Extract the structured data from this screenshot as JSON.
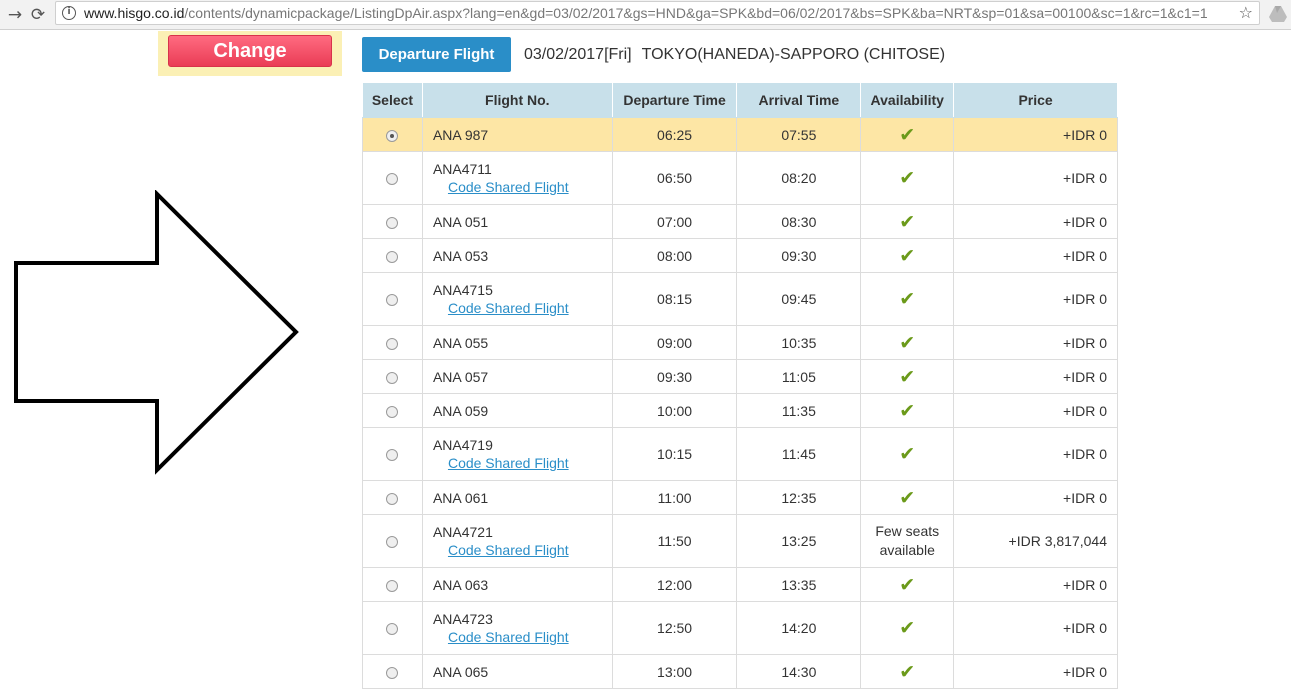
{
  "browser": {
    "back_glyph": "→",
    "reload_glyph": "⟳",
    "url_host": "www.hisgo.co.id",
    "url_path": "/contents/dynamicpackage/ListingDpAir.aspx?lang=en&gd=03/02/2017&gs=HND&ga=SPK&bd=06/02/2017&bs=SPK&ba=NRT&sp=01&sa=00100&sc=1&rc=1&c1=1",
    "icons": [
      "info-icon",
      "star-icon",
      "drive-icon"
    ]
  },
  "change_button": "Change",
  "departure": {
    "label": "Departure Flight",
    "date": "03/02/2017[Fri]",
    "route": "TOKYO(HANEDA)-SAPPORO (CHITOSE)"
  },
  "table": {
    "headers": [
      "Select",
      "Flight No.",
      "Departure Time",
      "Arrival Time",
      "Availability",
      "Price"
    ],
    "code_share_label": "Code Shared Flight",
    "rows": [
      {
        "flight": "ANA 987",
        "code_share": false,
        "dep": "06:25",
        "arr": "07:55",
        "avail": "✔",
        "price": "+IDR 0",
        "selected": true
      },
      {
        "flight": "ANA4711",
        "code_share": true,
        "dep": "06:50",
        "arr": "08:20",
        "avail": "✔",
        "price": "+IDR 0",
        "selected": false
      },
      {
        "flight": "ANA 051",
        "code_share": false,
        "dep": "07:00",
        "arr": "08:30",
        "avail": "✔",
        "price": "+IDR 0",
        "selected": false
      },
      {
        "flight": "ANA 053",
        "code_share": false,
        "dep": "08:00",
        "arr": "09:30",
        "avail": "✔",
        "price": "+IDR 0",
        "selected": false
      },
      {
        "flight": "ANA4715",
        "code_share": true,
        "dep": "08:15",
        "arr": "09:45",
        "avail": "✔",
        "price": "+IDR 0",
        "selected": false
      },
      {
        "flight": "ANA 055",
        "code_share": false,
        "dep": "09:00",
        "arr": "10:35",
        "avail": "✔",
        "price": "+IDR 0",
        "selected": false
      },
      {
        "flight": "ANA 057",
        "code_share": false,
        "dep": "09:30",
        "arr": "11:05",
        "avail": "✔",
        "price": "+IDR 0",
        "selected": false
      },
      {
        "flight": "ANA 059",
        "code_share": false,
        "dep": "10:00",
        "arr": "11:35",
        "avail": "✔",
        "price": "+IDR 0",
        "selected": false
      },
      {
        "flight": "ANA4719",
        "code_share": true,
        "dep": "10:15",
        "arr": "11:45",
        "avail": "✔",
        "price": "+IDR 0",
        "selected": false
      },
      {
        "flight": "ANA 061",
        "code_share": false,
        "dep": "11:00",
        "arr": "12:35",
        "avail": "✔",
        "price": "+IDR 0",
        "selected": false
      },
      {
        "flight": "ANA4721",
        "code_share": true,
        "dep": "11:50",
        "arr": "13:25",
        "avail": "Few seats available",
        "price": "+IDR 3,817,044",
        "selected": false
      },
      {
        "flight": "ANA 063",
        "code_share": false,
        "dep": "12:00",
        "arr": "13:35",
        "avail": "✔",
        "price": "+IDR 0",
        "selected": false
      },
      {
        "flight": "ANA4723",
        "code_share": true,
        "dep": "12:50",
        "arr": "14:20",
        "avail": "✔",
        "price": "+IDR 0",
        "selected": false
      },
      {
        "flight": "ANA 065",
        "code_share": false,
        "dep": "13:00",
        "arr": "14:30",
        "avail": "✔",
        "price": "+IDR 0",
        "selected": false
      }
    ]
  }
}
